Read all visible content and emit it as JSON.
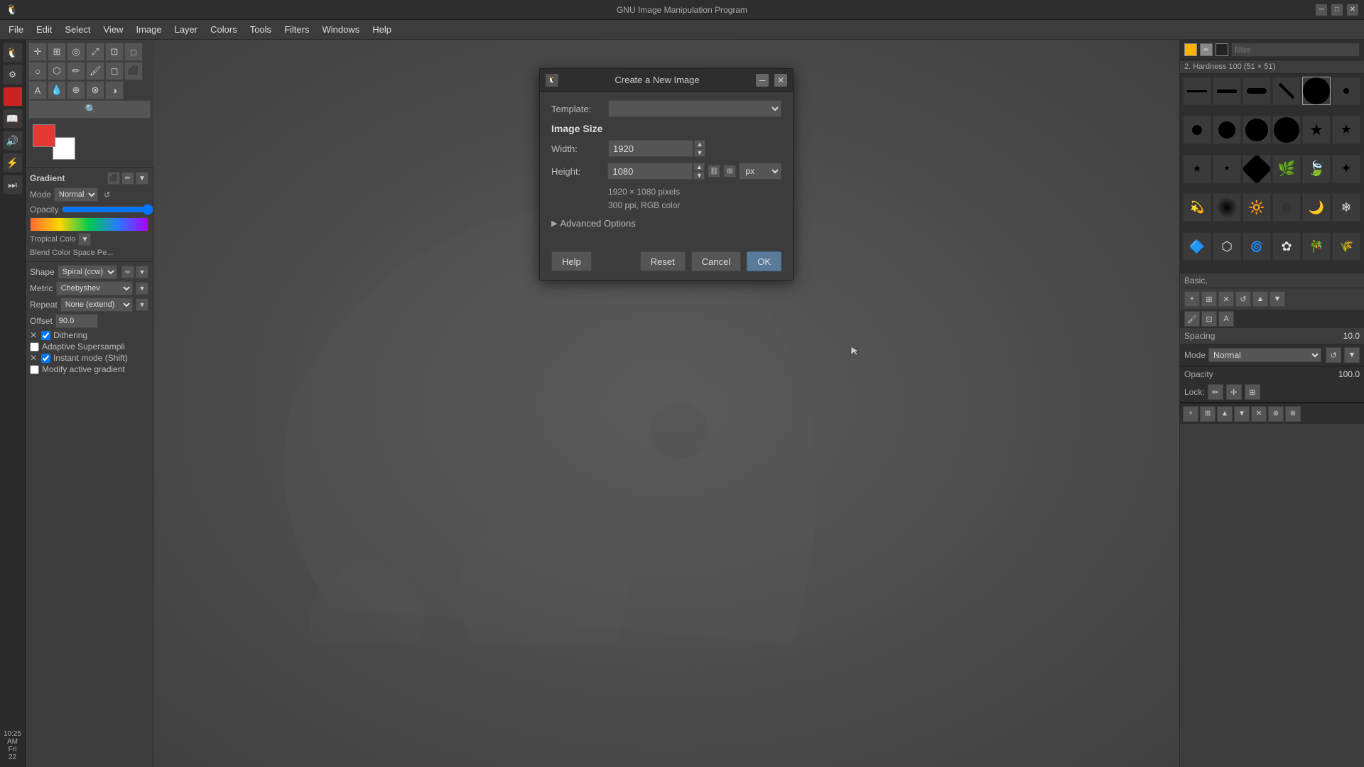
{
  "app": {
    "title": "GNU Image Manipulation Program",
    "icon": "🎨"
  },
  "titlebar": {
    "title": "GNU Image Manipulation Program",
    "minimize_label": "─",
    "maximize_label": "□",
    "close_label": "✕"
  },
  "menubar": {
    "items": [
      {
        "label": "File"
      },
      {
        "label": "Edit"
      },
      {
        "label": "Select"
      },
      {
        "label": "View"
      },
      {
        "label": "Image"
      },
      {
        "label": "Layer"
      },
      {
        "label": "Colors"
      },
      {
        "label": "Tools"
      },
      {
        "label": "Filters"
      },
      {
        "label": "Windows"
      },
      {
        "label": "Help"
      }
    ]
  },
  "left_panel": {
    "gradient": {
      "label": "Gradient",
      "mode_label": "Mode",
      "mode_value": "Normal",
      "opacity_label": "Opacity",
      "opacity_value": "100.0",
      "name": "Tropical Colo",
      "blend_label": "Blend Color Space Pe..."
    },
    "tool_options": {
      "shape_label": "Shape",
      "shape_value": "Spiral (ccw)",
      "metric_label": "Metric",
      "metric_value": "Chebyshev",
      "repeat_label": "Repeat",
      "repeat_value": "None (extend)",
      "offset_label": "Offset",
      "offset_value": "90.0",
      "dithering_label": "Dithering",
      "dithering_checked": true,
      "adaptive_label": "Adaptive Supersampli",
      "adaptive_checked": false,
      "instant_label": "Instant mode  (Shift)",
      "instant_checked": true,
      "modify_label": "Modify active gradient",
      "modify_checked": false
    }
  },
  "dialog": {
    "title": "Create a New Image",
    "icon": "🖼",
    "template_label": "Template:",
    "template_placeholder": "",
    "image_size_label": "Image Size",
    "width_label": "Width:",
    "width_value": "1920",
    "height_label": "Height:",
    "height_value": "1080",
    "unit_value": "px",
    "info_pixels": "1920 × 1080 pixels",
    "info_res": "300 ppi, RGB color",
    "advanced_label": "Advanced Options",
    "help_btn": "Help",
    "reset_btn": "Reset",
    "cancel_btn": "Cancel",
    "ok_btn": "OK"
  },
  "right_panel": {
    "filter_placeholder": "filter",
    "hardness_label": "2. Hardness 100 (51 × 51)",
    "preset_label": "Basic,",
    "spacing_label": "Spacing",
    "spacing_value": "10.0",
    "mode_label": "Mode",
    "mode_value": "Normal",
    "opacity_label": "Opacity",
    "opacity_value": "100.0",
    "lock_label": "Lock:",
    "colors": {
      "primary": "#ffb300",
      "secondary": "#444444",
      "tertiary": "#ffffff"
    }
  },
  "clock": {
    "time": "10:25 AM",
    "day": "Fri",
    "date": "22"
  }
}
